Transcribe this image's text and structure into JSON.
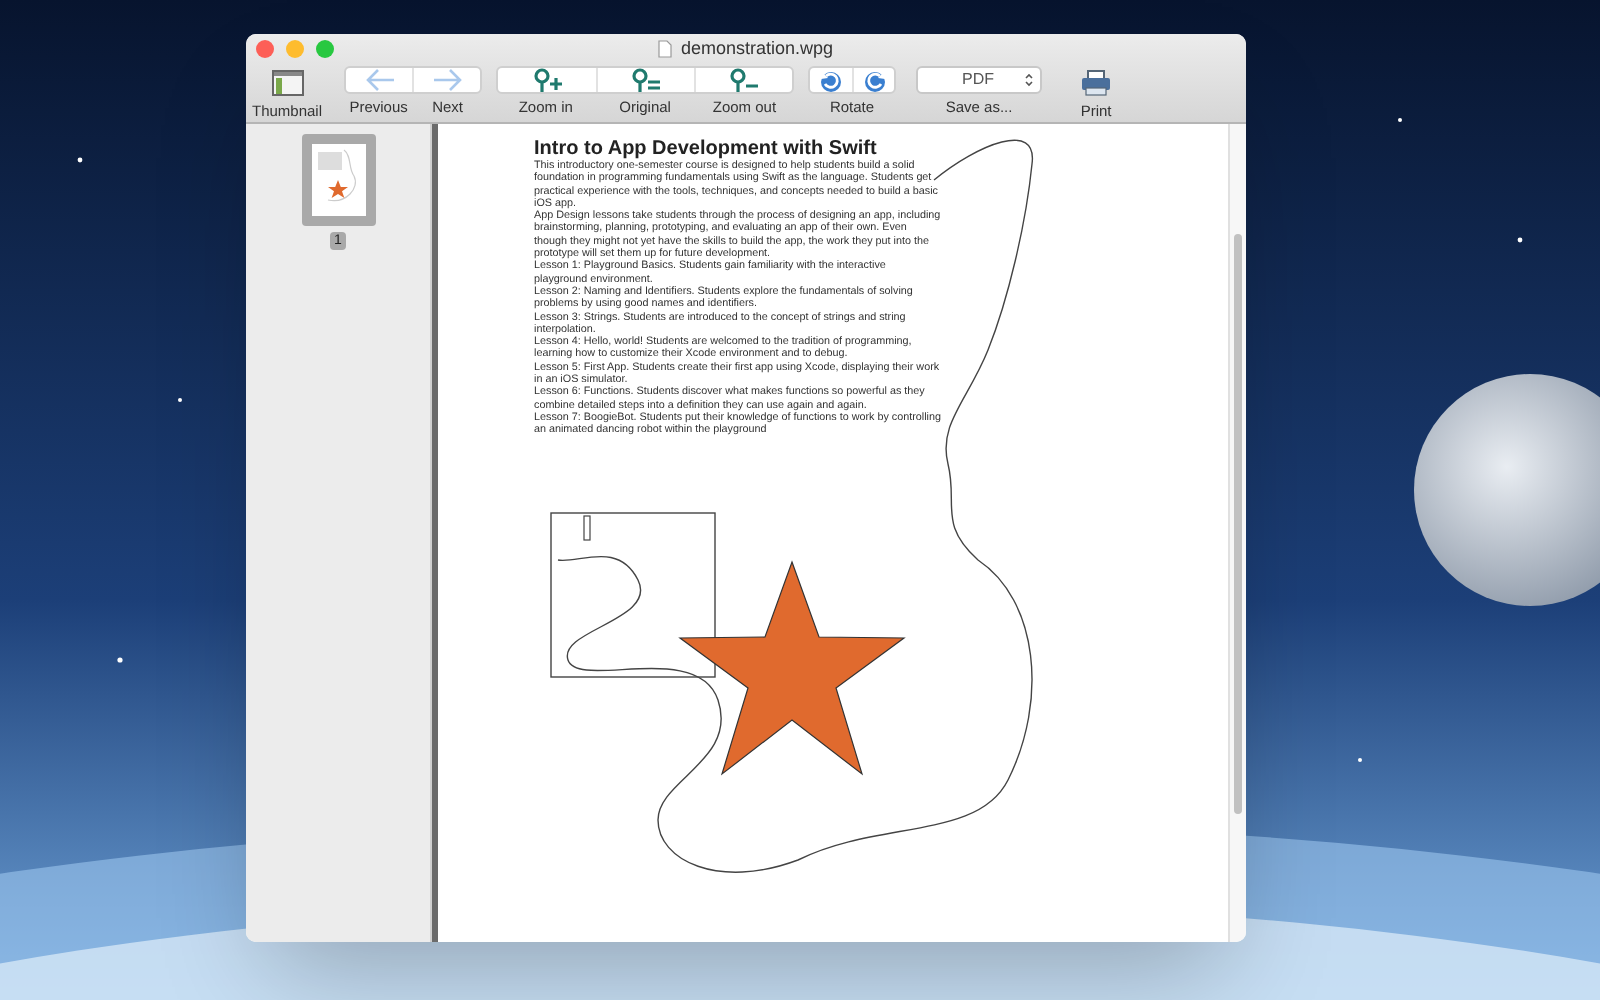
{
  "window": {
    "title": "demonstration.wpg"
  },
  "toolbar": [
    {
      "kind": "button",
      "segments": [
        {
          "kind": "sidebar"
        }
      ],
      "labels": [
        "Thumbnail"
      ]
    },
    {
      "kind": "segmented",
      "segments": [
        {
          "kind": "back"
        },
        {
          "kind": "forward"
        }
      ],
      "labels": [
        "Previous",
        "Next"
      ]
    },
    {
      "kind": "segmented",
      "segments": [
        {
          "kind": "zoom-in"
        },
        {
          "kind": "zoom-reset"
        },
        {
          "kind": "zoom-out"
        }
      ],
      "labels": [
        "Zoom in",
        "Original",
        "Zoom out"
      ]
    },
    {
      "kind": "segmented",
      "segments": [
        {
          "kind": "rotate-left"
        },
        {
          "kind": "rotate-right"
        }
      ],
      "labels": [
        "Rotate"
      ]
    },
    {
      "kind": "popup",
      "value": "PDF",
      "labels": [
        "Save as..."
      ]
    },
    {
      "kind": "button",
      "segments": [
        {
          "kind": "printer"
        }
      ],
      "labels": [
        "Print"
      ]
    }
  ],
  "thumbnails": [
    {
      "page": "1",
      "selected": true
    }
  ],
  "document": {
    "title": "Intro to App Development with Swift",
    "paragraphs": [
      "This introductory one-semester course is designed to help students build a solid foundation in programming fundamentals using Swift as the language. Students get practical experience with the tools, techniques, and concepts needed to build a basic iOS app.",
      "App Design lessons take students through the process of designing an app, including brainstorming, planning, prototyping, and evaluating an app of their own. Even though they might not yet have the skills to build the app, the work they put into the prototype will set them up for future development.",
      "Lesson 1: Playground Basics. Students gain familiarity with the interactive playground environment.",
      "Lesson 2: Naming and Identifiers. Students explore the fundamentals of solving problems by using good names and identifiers.",
      "Lesson 3: Strings. Students are introduced to the concept of strings and string interpolation.",
      "Lesson 4: Hello, world! Students are welcomed to the tradition of programming, learning how to customize their Xcode environment and to debug.",
      "Lesson 5: First App. Students create their first app using Xcode, displaying their work in an iOS simulator.",
      "Lesson 6: Functions. Students discover what makes functions so powerful as they combine detailed steps into a definition they can use again and again.",
      "Lesson 7: BoogieBot. Students put their knowledge of functions to work by controlling an animated dancing robot within the playground"
    ]
  }
}
